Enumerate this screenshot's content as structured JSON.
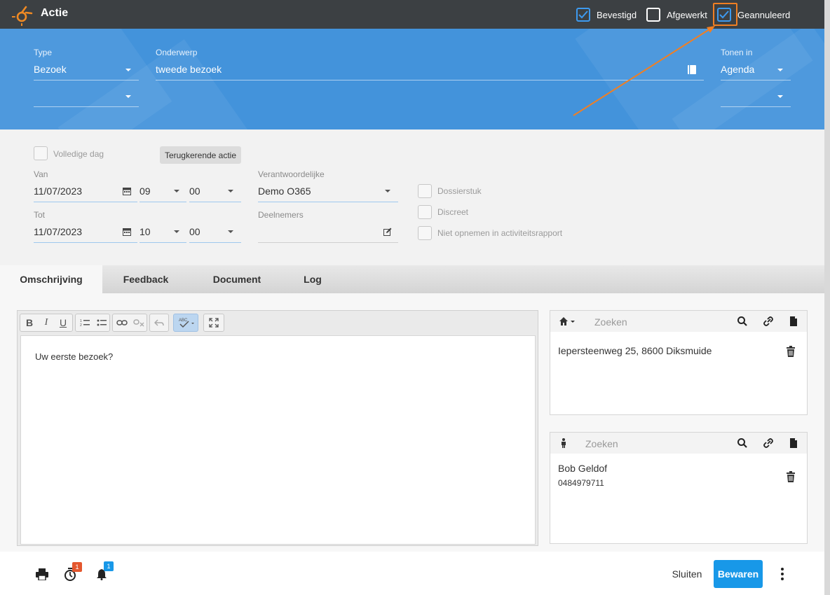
{
  "app": {
    "title": "Actie"
  },
  "status": {
    "bevestigd": {
      "label": "Bevestigd",
      "checked": true
    },
    "afgewerkt": {
      "label": "Afgewerkt",
      "checked": false
    },
    "geannuleerd": {
      "label": "Geannuleerd",
      "checked": true
    }
  },
  "header": {
    "type_label": "Type",
    "type_value": "Bezoek",
    "subtype_value": "",
    "subject_label": "Onderwerp",
    "subject_value": "tweede bezoek",
    "show_in_label": "Tonen in",
    "show_in_value": "Agenda",
    "show_in_sub_value": ""
  },
  "form": {
    "full_day_label": "Volledige dag",
    "recurring_button": "Terugkerende actie",
    "from_label": "Van",
    "from_date": "11/07/2023",
    "from_hour": "09",
    "from_min": "00",
    "to_label": "Tot",
    "to_date": "11/07/2023",
    "to_hour": "10",
    "to_min": "00",
    "responsible_label": "Verantwoordelijke",
    "responsible_value": "Demo O365",
    "participants_label": "Deelnemers",
    "participants_value": "",
    "checks": [
      {
        "label": "Dossierstuk",
        "checked": false
      },
      {
        "label": "Discreet",
        "checked": false
      },
      {
        "label": "Niet opnemen in activiteitsrapport",
        "checked": false
      }
    ]
  },
  "tabs": [
    {
      "label": "Omschrijving",
      "active": true
    },
    {
      "label": "Feedback",
      "active": false
    },
    {
      "label": "Document",
      "active": false
    },
    {
      "label": "Log",
      "active": false
    }
  ],
  "editor": {
    "text": "Uw eerste bezoek?",
    "toolbar": [
      "bold-icon",
      "italic-icon",
      "underline-icon",
      "ordered-list-icon",
      "bullet-list-icon",
      "link-icon",
      "unlink-icon",
      "undo-icon",
      "spellcheck-icon",
      "maximize-icon"
    ]
  },
  "address_panel": {
    "search_placeholder": "Zoeken",
    "address": "Iepersteenweg 25, 8600 Diksmuide"
  },
  "contact_panel": {
    "search_placeholder": "Zoeken",
    "name": "Bob Geldof",
    "phone": "0484979711"
  },
  "footer": {
    "timer_badge": "1",
    "notification_badge": "1",
    "close_label": "Sluiten",
    "save_label": "Bewaren"
  },
  "colors": {
    "topbar": "#3c4043",
    "header_blue": "#4393db",
    "accent": "#1898e8",
    "highlight": "#f07f23",
    "badge_red": "#e4572e",
    "badge_blue": "#1898e8"
  }
}
